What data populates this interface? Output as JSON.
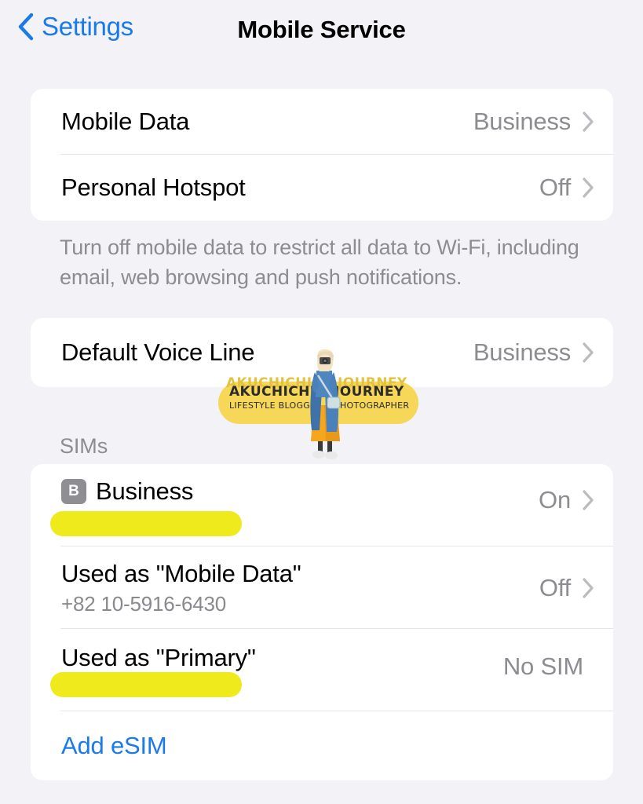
{
  "nav": {
    "back_label": "Settings",
    "back_icon": "chevron-left-icon",
    "title": "Mobile Service"
  },
  "sections": [
    {
      "id": "data-section",
      "rows": [
        {
          "title": "Mobile Data",
          "value": "Business",
          "accessory": "chevron-right-icon"
        },
        {
          "title": "Personal Hotspot",
          "value": "Off",
          "accessory": "chevron-right-icon"
        }
      ],
      "footer": "Turn off mobile data to restrict all data to Wi-Fi, including email, web browsing and push notifications."
    },
    {
      "id": "voice-section",
      "rows": [
        {
          "title": "Default Voice Line",
          "value": "Business",
          "accessory": "chevron-right-icon"
        }
      ]
    },
    {
      "id": "sims-section",
      "header": "SIMs",
      "rows": [
        {
          "badge": "B",
          "title": "Business",
          "value": "On",
          "accessory": "chevron-right-icon",
          "redacted": true
        },
        {
          "title": "Used as \"Mobile Data\"",
          "subtitle": "+82 10-5916-6430",
          "value": "Off",
          "accessory": "chevron-right-icon"
        },
        {
          "title": "Used as \"Primary\"",
          "value": "No SIM",
          "accessory": "none",
          "redacted": true
        },
        {
          "title": "Add eSIM",
          "link": true
        }
      ]
    }
  ],
  "watermark": {
    "brand_left": "AKUCHICHIE",
    "sub_left": "LIFESTYLE BLOGGER",
    "brand_right": "JOURNEY",
    "sub_right": "PHOTOGRAPHER",
    "ghost_left": "AKUCHICHIE",
    "ghost_right": "JOURNEY"
  },
  "colors": {
    "accent_blue": "#1b7aea",
    "background": "#f2f2f7",
    "card": "#ffffff",
    "secondary_text": "#8c8c91",
    "redaction_yellow": "#eeea1b",
    "badge_gray": "#8e8e93",
    "watermark_yellow": "#f5d54e"
  }
}
